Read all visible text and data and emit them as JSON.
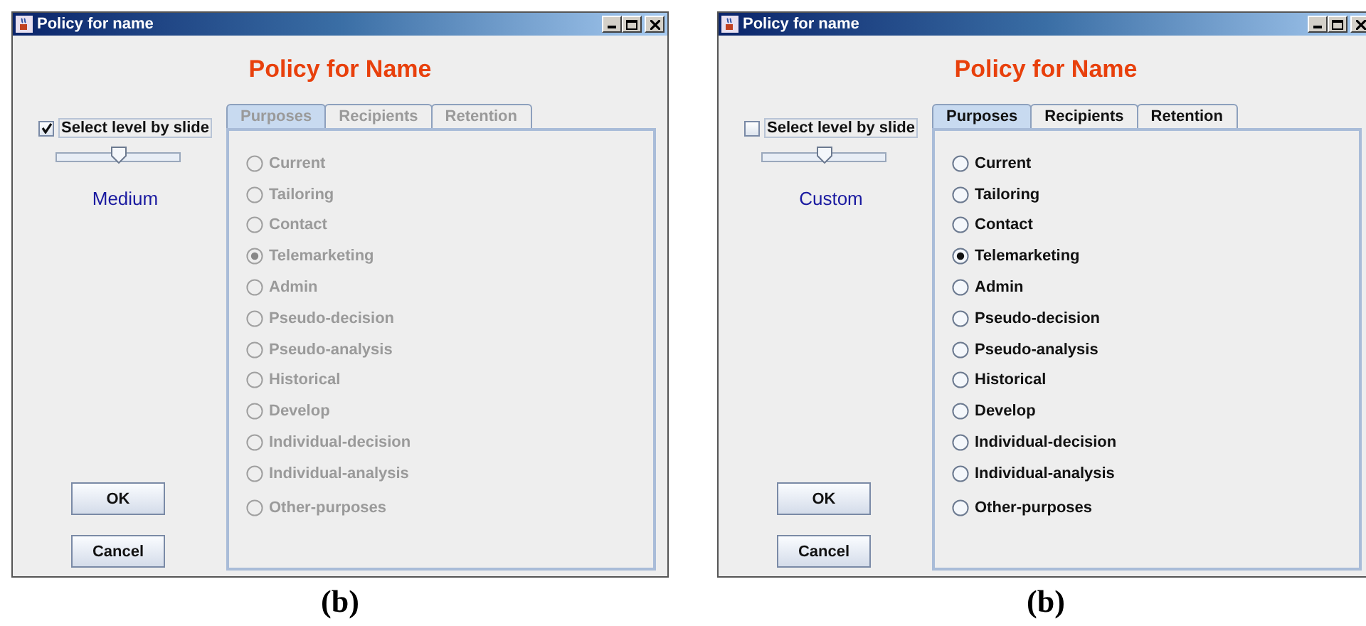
{
  "panels": [
    {
      "window": {
        "title": "Policy for name"
      },
      "heading": "Policy for Name",
      "slide_checkbox": {
        "label": "Select level by slide",
        "checked": true
      },
      "slider": {
        "level": 0.5
      },
      "level_label": "Medium",
      "tabs_disabled": true,
      "tabs": [
        {
          "label": "Purposes",
          "selected": true
        },
        {
          "label": "Recipients",
          "selected": false
        },
        {
          "label": "Retention",
          "selected": false
        }
      ],
      "purposes": [
        {
          "label": "Current",
          "selected": false
        },
        {
          "label": "Tailoring",
          "selected": false
        },
        {
          "label": "Contact",
          "selected": false
        },
        {
          "label": "Telemarketing",
          "selected": true
        },
        {
          "label": "Admin",
          "selected": false
        },
        {
          "label": "Pseudo-decision",
          "selected": false
        },
        {
          "label": "Pseudo-analysis",
          "selected": false
        },
        {
          "label": "Historical",
          "selected": false
        },
        {
          "label": "Develop",
          "selected": false
        },
        {
          "label": "Individual-decision",
          "selected": false
        },
        {
          "label": "Individual-analysis",
          "selected": false
        },
        {
          "label": "Other-purposes",
          "selected": false
        }
      ],
      "buttons": [
        "OK",
        "Cancel"
      ],
      "caption": "(b)"
    },
    {
      "window": {
        "title": "Policy for name"
      },
      "heading": "Policy for Name",
      "slide_checkbox": {
        "label": "Select level by slide",
        "checked": false
      },
      "slider": {
        "level": 0.5
      },
      "level_label": "Custom",
      "tabs_disabled": false,
      "tabs": [
        {
          "label": "Purposes",
          "selected": true
        },
        {
          "label": "Recipients",
          "selected": false
        },
        {
          "label": "Retention",
          "selected": false
        }
      ],
      "purposes": [
        {
          "label": "Current",
          "selected": false
        },
        {
          "label": "Tailoring",
          "selected": false
        },
        {
          "label": "Contact",
          "selected": false
        },
        {
          "label": "Telemarketing",
          "selected": true
        },
        {
          "label": "Admin",
          "selected": false
        },
        {
          "label": "Pseudo-decision",
          "selected": false
        },
        {
          "label": "Pseudo-analysis",
          "selected": false
        },
        {
          "label": "Historical",
          "selected": false
        },
        {
          "label": "Develop",
          "selected": false
        },
        {
          "label": "Individual-decision",
          "selected": false
        },
        {
          "label": "Individual-analysis",
          "selected": false
        },
        {
          "label": "Other-purposes",
          "selected": false
        }
      ],
      "buttons": [
        "OK",
        "Cancel"
      ],
      "caption": "(b)"
    }
  ]
}
